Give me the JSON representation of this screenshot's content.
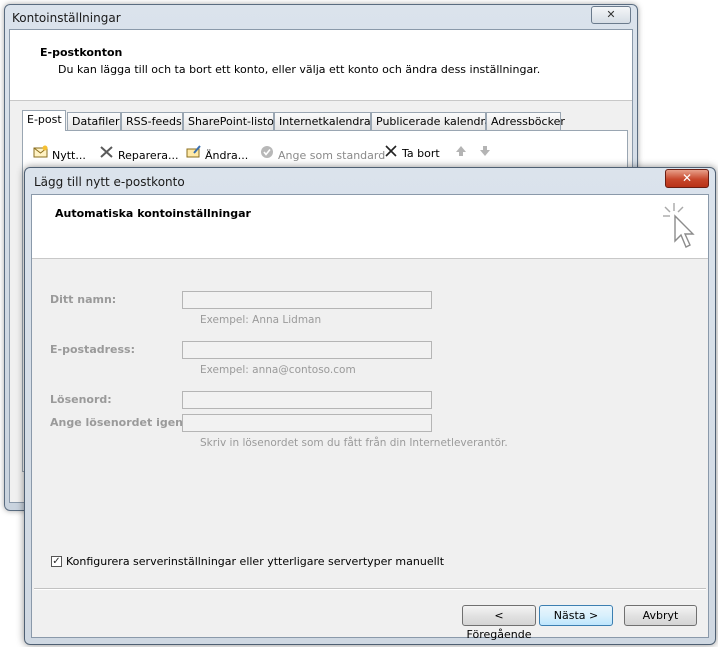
{
  "back_window": {
    "title": "Kontoinställningar",
    "close_label": "✕",
    "header_title": "E-postkonton",
    "header_desc": "Du kan lägga till och ta bort ett konto, eller välja ett konto och ändra dess inställningar.",
    "tabs": [
      "E-post",
      "Datafiler",
      "RSS-feeds",
      "SharePoint-listor",
      "Internetkalendrar",
      "Publicerade kalendrar",
      "Adressböcker"
    ],
    "toolbar": {
      "new": "Nytt...",
      "repair": "Reparera...",
      "change": "Ändra...",
      "set_default": "Ange som standard",
      "remove": "Ta bort"
    }
  },
  "dialog": {
    "title": "Lägg till nytt e-postkonto",
    "close_label": "✕",
    "header_title": "Automatiska kontoinställningar",
    "name_label": "Ditt namn:",
    "name_value": "",
    "name_hint": "Exempel: Anna Lidman",
    "email_label": "E-postadress:",
    "email_value": "",
    "email_hint": "Exempel: anna@contoso.com",
    "password_label": "Lösenord:",
    "password_value": "",
    "password_again_label": "Ange lösenordet igen:",
    "password_again_value": "",
    "password_hint": "Skriv in lösenordet som du fått från din Internetleverantör.",
    "manual_checkbox_mark": "✓",
    "manual_checkbox_label": "Konfigurera serverinställningar eller ytterligare servertyper manuellt",
    "back_button": "< Föregående",
    "next_button": "Nästa >",
    "cancel_button": "Avbryt"
  },
  "colors": {
    "close_red": "#c7472b",
    "default_button_blue": "#3c7fb1",
    "disabled_gray": "#9a9a9a"
  },
  "icons": [
    "new-mail-icon",
    "repair-icon",
    "change-icon",
    "set-default-icon",
    "remove-icon",
    "move-up-icon",
    "move-down-icon",
    "auto-setup-cursor-icon"
  ]
}
